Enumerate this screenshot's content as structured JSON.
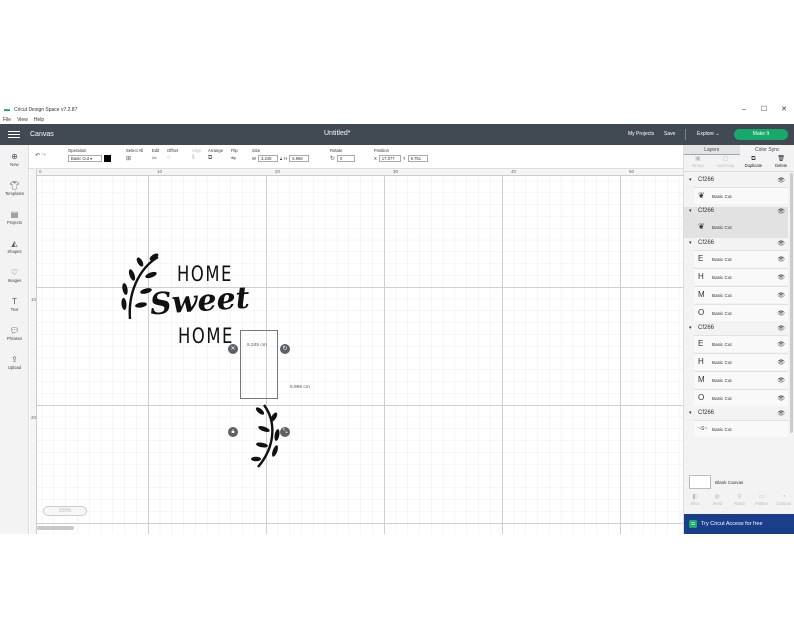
{
  "window": {
    "title": "Cricut Design Space  v7.2.87",
    "controls": [
      "–",
      "☐",
      "✕"
    ]
  },
  "menubar": [
    "File",
    "View",
    "Help"
  ],
  "header": {
    "section": "Canvas",
    "doc_title": "Untitled*",
    "my_projects": "My Projects",
    "save": "Save",
    "explore": "Explore",
    "make_it": "Make It"
  },
  "toolbar": {
    "operation_label": "Operation",
    "operation_value": "Basic Cut",
    "select_all": "Select All",
    "edit": "Edit",
    "offset": "Offset",
    "align": "Align",
    "arrange": "Arrange",
    "flip": "Flip",
    "size_label": "Size",
    "w_label": "W",
    "w_value": "3.245",
    "h_label": "H",
    "h_value": "5.966",
    "rotate_label": "Rotate",
    "rotate_value": "0",
    "position_label": "Position",
    "x_label": "X",
    "x_value": "17.077",
    "y_label": "Y",
    "y_value": "9.751"
  },
  "sidebar": [
    {
      "icon": "plus-icon",
      "label": "New"
    },
    {
      "icon": "shirt-icon",
      "label": "Templates"
    },
    {
      "icon": "projects-icon",
      "label": "Projects"
    },
    {
      "icon": "shapes-icon",
      "label": "Shapes"
    },
    {
      "icon": "image-icon",
      "label": "Images"
    },
    {
      "icon": "text-icon",
      "label": "Text"
    },
    {
      "icon": "phrases-icon",
      "label": "Phrases"
    },
    {
      "icon": "upload-icon",
      "label": "Upload"
    }
  ],
  "rulers": {
    "top": [
      "0",
      "10",
      "20",
      "30",
      "40",
      "50"
    ],
    "left": [
      "10",
      "20"
    ]
  },
  "zoom": "100%",
  "design": {
    "line1": "HOME",
    "line2": "Sweet",
    "line3": "HOME",
    "width_label": "9.245 cm",
    "height_label": "5.966 cm"
  },
  "right_panel": {
    "tabs": [
      "Layers",
      "Color Sync"
    ],
    "actions": [
      "Group",
      "UnGroup",
      "Duplicate",
      "Delete"
    ],
    "groups": [
      {
        "name": "Cf266",
        "rows": [
          "Basic Cut"
        ]
      },
      {
        "name": "Cf266",
        "rows": [
          "Basic Cut"
        ]
      },
      {
        "name": "Cf266",
        "rows": [
          "Basic Cut",
          "Basic Cut",
          "Basic Cut",
          "Basic Cut"
        ]
      },
      {
        "name": "Cf266",
        "rows": [
          "Basic Cut",
          "Basic Cut",
          "Basic Cut",
          "Basic Cut"
        ]
      },
      {
        "name": "Cf266",
        "rows": [
          "Basic Cut"
        ]
      }
    ],
    "blank_canvas": "Blank Canvas",
    "bottom_actions": [
      "Slice",
      "Weld",
      "Attach",
      "Flatten",
      "Contour"
    ],
    "access": "Try Cricut Access for free"
  }
}
